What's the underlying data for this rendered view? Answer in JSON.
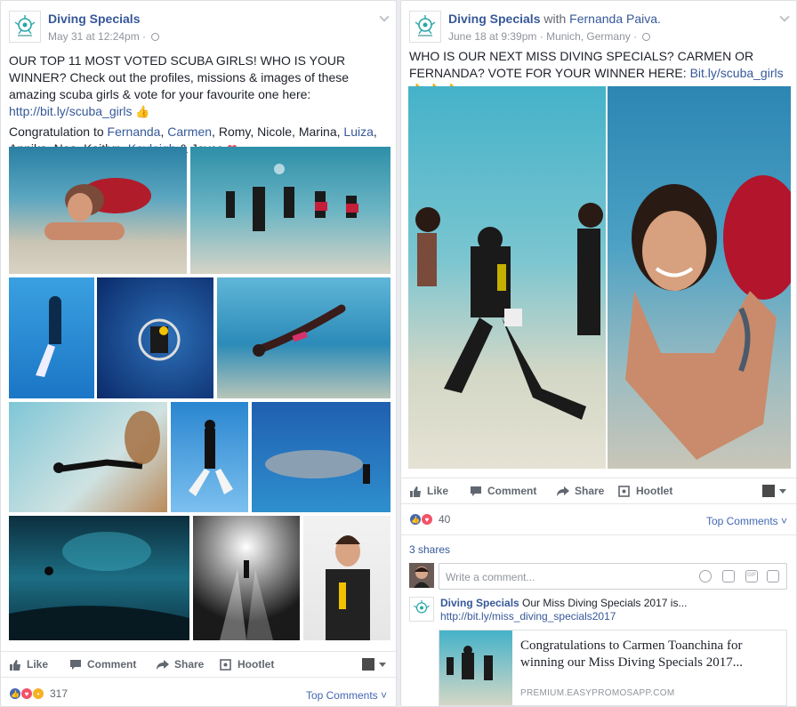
{
  "post1": {
    "page_name": "Diving Specials",
    "meta": "May 31 at 12:24pm · ",
    "text": {
      "line1": "OUR TOP 11 MOST VOTED SCUBA GIRLS! WHO IS YOUR WINNER? Check out the profiles, missions & images of these amazing scuba girls & vote for your favourite one here: ",
      "link": "http://bit.ly/scuba_girls",
      "congrats_intro": "Congratulation to ",
      "names": [
        "Fernanda",
        "Carmen",
        "Romy",
        "Nicole",
        "Marina",
        "Luiza",
        "Annika",
        "Noa",
        "Kaitlyn",
        "Kayleigh"
      ],
      "last": "Joyce"
    },
    "actions": {
      "like": "Like",
      "comment": "Comment",
      "share": "Share",
      "hootlet": "Hootlet"
    },
    "reactions_count": "317",
    "top_comments": "Top Comments"
  },
  "post2": {
    "page_name": "Diving Specials",
    "with_word": " with ",
    "with_name": "Fernanda Paiva.",
    "meta": "June 18 at 9:39pm · Munich, Germany · ",
    "text": {
      "line1": "WHO IS OUR NEXT MISS DIVING SPECIALS? CARMEN OR FERNANDA? VOTE FOR YOUR WINNER HERE: ",
      "link": "Bit.ly/scuba_girls"
    },
    "actions": {
      "like": "Like",
      "comment": "Comment",
      "share": "Share",
      "hootlet": "Hootlet"
    },
    "reactions_count": "40",
    "top_comments": "Top Comments",
    "shares": "3 shares",
    "comment_placeholder": "Write a comment...",
    "comment": {
      "author": "Diving Specials",
      "text": " Our Miss Diving Specials 2017 is...",
      "link": "http://bit.ly/miss_diving_specials2017"
    },
    "shared_link": {
      "title": "Congratulations to Carmen Toanchina for winning our Miss Diving Specials 2017...",
      "domain": "PREMIUM.EASYPROMOSAPP.COM"
    }
  },
  "colors": {
    "brand": "#365899",
    "accent": "#4267b2",
    "muted": "#90949c",
    "love": "#f25268"
  },
  "icons": [
    "diving-specials-logo",
    "globe-icon",
    "chevron-down-icon",
    "thumbs-up-icon",
    "comment-icon",
    "share-icon",
    "hootlet-icon",
    "heart-icon",
    "camera-icon",
    "gif-icon",
    "emoji-icon",
    "sticker-icon"
  ]
}
